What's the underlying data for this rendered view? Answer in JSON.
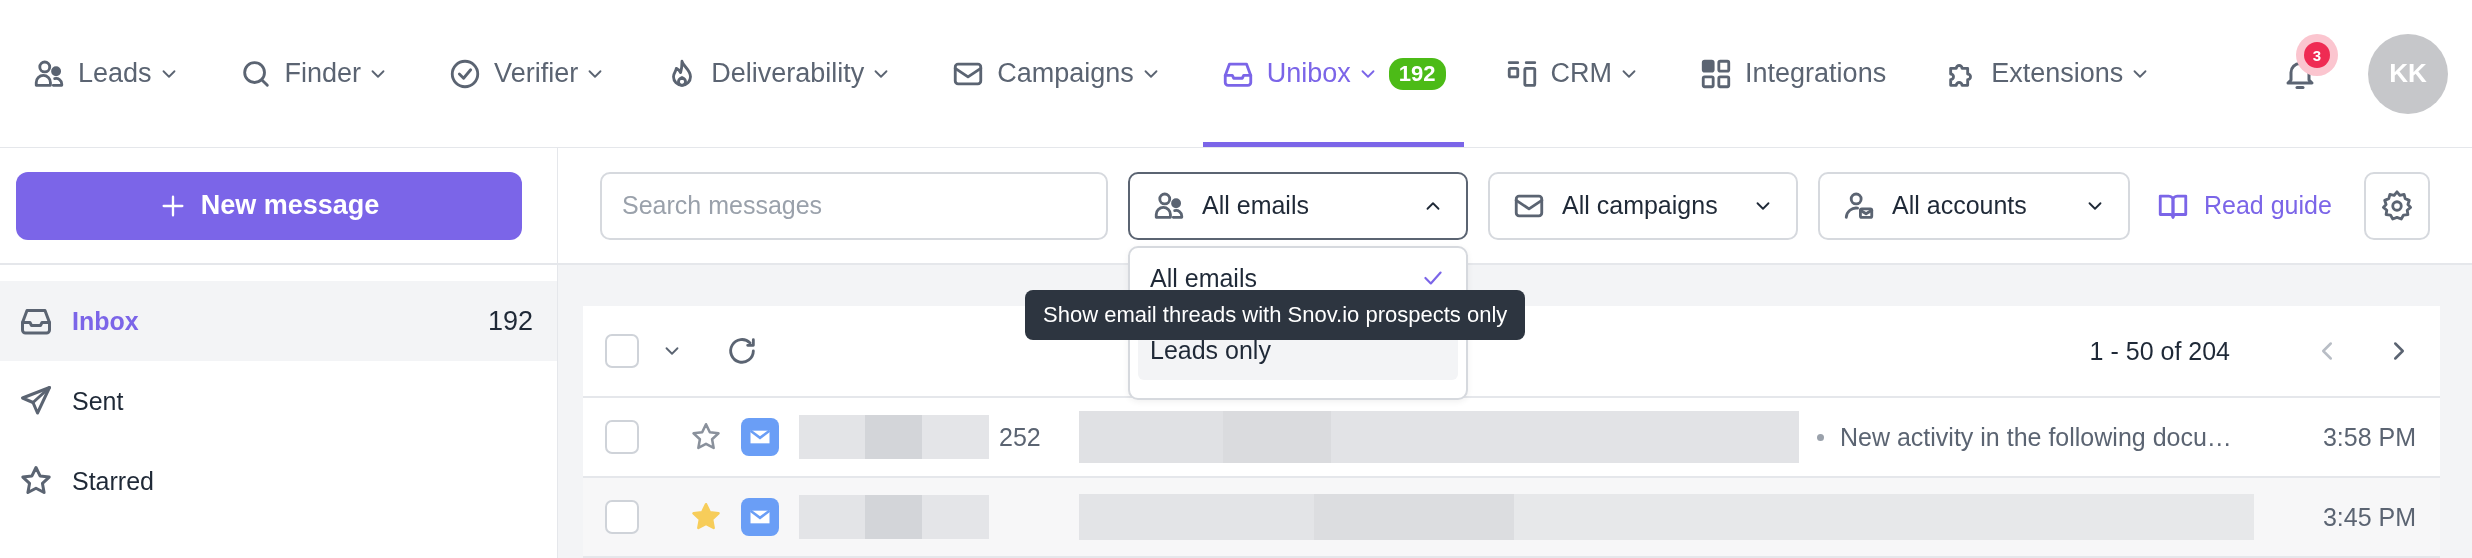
{
  "nav": {
    "items": [
      {
        "label": "Leads",
        "kind": "people",
        "caret": true,
        "selected": false
      },
      {
        "label": "Finder",
        "kind": "search",
        "caret": true,
        "selected": false
      },
      {
        "label": "Verifier",
        "kind": "check",
        "caret": true,
        "selected": false
      },
      {
        "label": "Deliverability",
        "kind": "flame",
        "caret": true,
        "selected": false
      },
      {
        "label": "Campaigns",
        "kind": "mail",
        "caret": true,
        "selected": false
      },
      {
        "label": "Unibox",
        "kind": "inbox",
        "caret": true,
        "selected": true,
        "badge": "192"
      },
      {
        "label": "CRM",
        "kind": "crm",
        "caret": true,
        "selected": false
      },
      {
        "label": "Integrations",
        "kind": "grid",
        "caret": false,
        "selected": false
      },
      {
        "label": "Extensions",
        "kind": "puzzle",
        "caret": true,
        "selected": false
      }
    ],
    "notifications": "3",
    "avatar": "KK"
  },
  "sidebar": {
    "new_message": "New message",
    "folders": [
      {
        "label": "Inbox",
        "kind": "inbox",
        "count": "192",
        "selected": true
      },
      {
        "label": "Sent",
        "kind": "send",
        "selected": false
      },
      {
        "label": "Starred",
        "kind": "star",
        "selected": false
      }
    ]
  },
  "toolbar": {
    "search": {
      "placeholder": "Search messages"
    },
    "filters": [
      {
        "label": "All emails",
        "kind": "people",
        "expanded": true
      },
      {
        "label": "All campaigns",
        "kind": "mail",
        "expanded": false
      },
      {
        "label": "All accounts",
        "kind": "account",
        "expanded": false
      }
    ],
    "read_guide": "Read guide"
  },
  "dropdown": {
    "options": [
      {
        "label": "All emails",
        "selected": true,
        "highlighted": false
      },
      {
        "label": "Leads only",
        "selected": false,
        "highlighted": true
      }
    ],
    "tooltip": "Show email threads with Snov.io prospects only"
  },
  "list": {
    "select_all_checked": false,
    "pagination": "1 - 50 of 204",
    "rows": [
      {
        "checked": false,
        "starred": false,
        "count": "252",
        "snippet": "New activity in the following docu…",
        "time": "3:58 PM"
      },
      {
        "checked": false,
        "starred": true,
        "time": "3:45 PM"
      }
    ]
  }
}
